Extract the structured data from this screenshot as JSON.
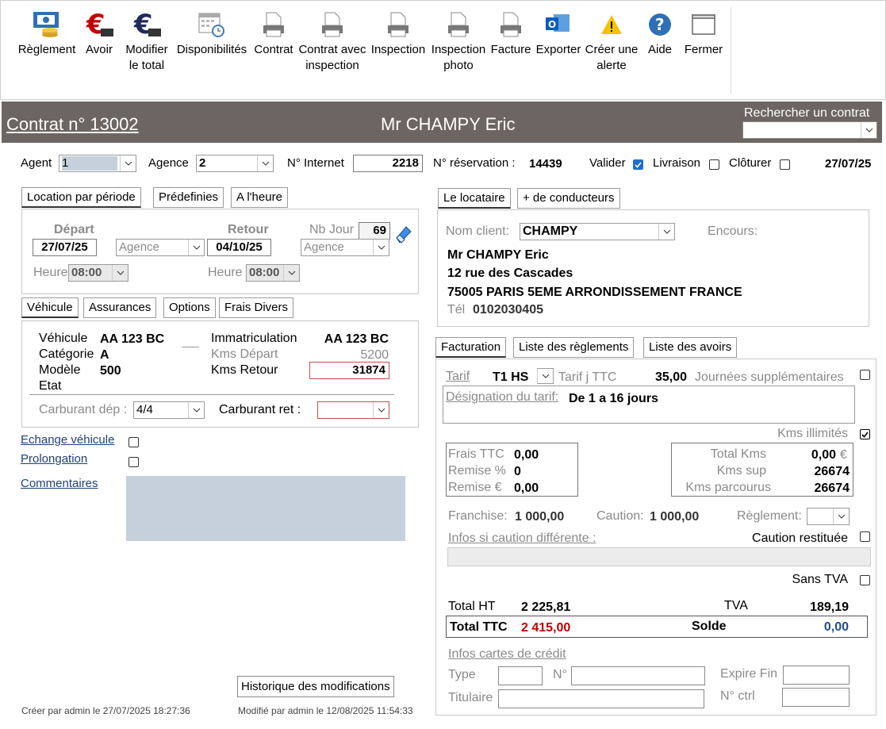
{
  "toolbar": {
    "items": [
      {
        "label": "Règlement",
        "icon": "payment-icon"
      },
      {
        "label": "Avoir",
        "icon": "euro-credit-icon"
      },
      {
        "label": "Modifier le total",
        "icon": "euro-edit-icon"
      },
      {
        "label": "Disponibilités",
        "icon": "calendar-icon"
      },
      {
        "label": "Contrat",
        "icon": "printer-icon"
      },
      {
        "label": "Contrat avec inspection",
        "icon": "printer-icon"
      },
      {
        "label": "Inspection",
        "icon": "printer-icon"
      },
      {
        "label": "Inspection photo",
        "icon": "printer-icon"
      },
      {
        "label": "Facture",
        "icon": "printer-icon"
      },
      {
        "label": "Exporter",
        "icon": "outlook-icon"
      },
      {
        "label": "Créer une alerte",
        "icon": "warning-icon"
      },
      {
        "label": "Aide",
        "icon": "help-icon"
      },
      {
        "label": "Fermer",
        "icon": "close-window-icon"
      }
    ]
  },
  "header": {
    "contract": "Contrat n° 13002",
    "client": "Mr CHAMPY  Eric",
    "search_label": "Rechercher un contrat",
    "search_value": ""
  },
  "top": {
    "agent_label": "Agent",
    "agent_value": "1",
    "agence_label": "Agence",
    "agence_value": "2",
    "internet_label": "N° Internet",
    "internet_value": "2218",
    "reservation_label": "N° réservation :",
    "reservation_value": "14439",
    "valider_label": "Valider",
    "livraison_label": "Livraison",
    "cloturer_label": "Clôturer",
    "date": "27/07/25"
  },
  "period_tabs": [
    "Location par période",
    "Prédefinies",
    "A l'heure"
  ],
  "period": {
    "depart_label": "Départ",
    "depart_date": "27/07/25",
    "depart_place": "Agence",
    "retour_label": "Retour",
    "retour_date": "04/10/25",
    "retour_place": "Agence",
    "nb_jour_label": "Nb Jour",
    "nb_jour": "69",
    "heure_label": "Heure",
    "heure_dep": "08:00",
    "heure_ret": "08:00"
  },
  "vehicle_tabs": [
    "Véhicule",
    "Assurances",
    "Options",
    "Frais Divers"
  ],
  "vehicle": {
    "vehicule_label": "Véhicule",
    "vehicule": "AA 123 BC",
    "categorie_label": "Catégorie",
    "categorie": "A",
    "modele_label": "Modèle",
    "modele": "500",
    "etat_label": "Etat",
    "immat_label": "Immatriculation",
    "immat": "AA 123 BC",
    "kms_dep_label": "Kms Départ",
    "kms_dep": "5200",
    "kms_ret_label": "Kms Retour",
    "kms_ret": "31874",
    "carb_dep_label": "Carburant dép :",
    "carb_dep": "4/4",
    "carb_ret_label": "Carburant ret :",
    "carb_ret": ""
  },
  "links": {
    "echange": "Echange véhicule",
    "prolongation": "Prolongation",
    "commentaires": "Commentaires"
  },
  "history_button": "Historique des modifications",
  "footer": {
    "created": "Créer par admin le 27/07/2025 18:27:36",
    "modified": "Modifié par admin le 12/08/2025 11:54:33"
  },
  "locataire_tabs": [
    "Le locataire",
    "+ de conducteurs"
  ],
  "locataire": {
    "nom_label": "Nom client:",
    "nom_value": "CHAMPY",
    "encours_label": "Encours:",
    "line1": "Mr CHAMPY Eric",
    "line2": "12 rue des Cascades",
    "line3": "75005 PARIS 5EME ARRONDISSEMENT FRANCE",
    "tel_label": "Tél",
    "tel": "0102030405"
  },
  "billing_tabs": [
    "Facturation",
    "Liste des règlements",
    "Liste des avoirs"
  ],
  "billing": {
    "tarif_label": "Tarif",
    "tarif_value": "T1 HS",
    "tarif_j_label": "Tarif j TTC",
    "tarif_j": "35,00",
    "journees_label": "Journées supplémentaires",
    "designation_label": "Désignation du tarif:",
    "designation": "De 1 a 16 jours",
    "kms_illimites_label": "Kms illimités",
    "frais_label": "Frais TTC",
    "frais": "0,00",
    "remise_pct_label": "Remise %",
    "remise_pct": "0",
    "remise_eur_label": "Remise  €",
    "remise_eur": "0,00",
    "total_kms_label": "Total Kms",
    "total_kms": "0,00",
    "euro": "€",
    "kms_sup_label": "Kms sup",
    "kms_sup": "26674",
    "kms_parc_label": "Kms parcourus",
    "kms_parc": "26674",
    "franchise_label": "Franchise:",
    "franchise": "1 000,00",
    "caution_label": "Caution:",
    "caution": "1 000,00",
    "reglement_label": "Règlement:",
    "infos_caution_label": "Infos si caution différente :",
    "caution_restituee_label": "Caution restituée",
    "sans_tva_label": "Sans TVA",
    "total_ht_label": "Total HT",
    "total_ht": "2 225,81",
    "tva_label": "TVA",
    "tva": "189,19",
    "total_ttc_label": "Total TTC",
    "total_ttc": "2 415,00",
    "solde_label": "Solde",
    "solde": "0,00",
    "cartes_label": "Infos cartes de crédit",
    "type_label": "Type",
    "no_label": "N°",
    "expire_label": "Expire Fin",
    "titulaire_label": "Titulaire",
    "ctrl_label": "N° ctrl"
  },
  "colors": {
    "header_bg": "#6d6561",
    "accent_red": "#c00000",
    "accent_blue": "#1f4e8c"
  }
}
